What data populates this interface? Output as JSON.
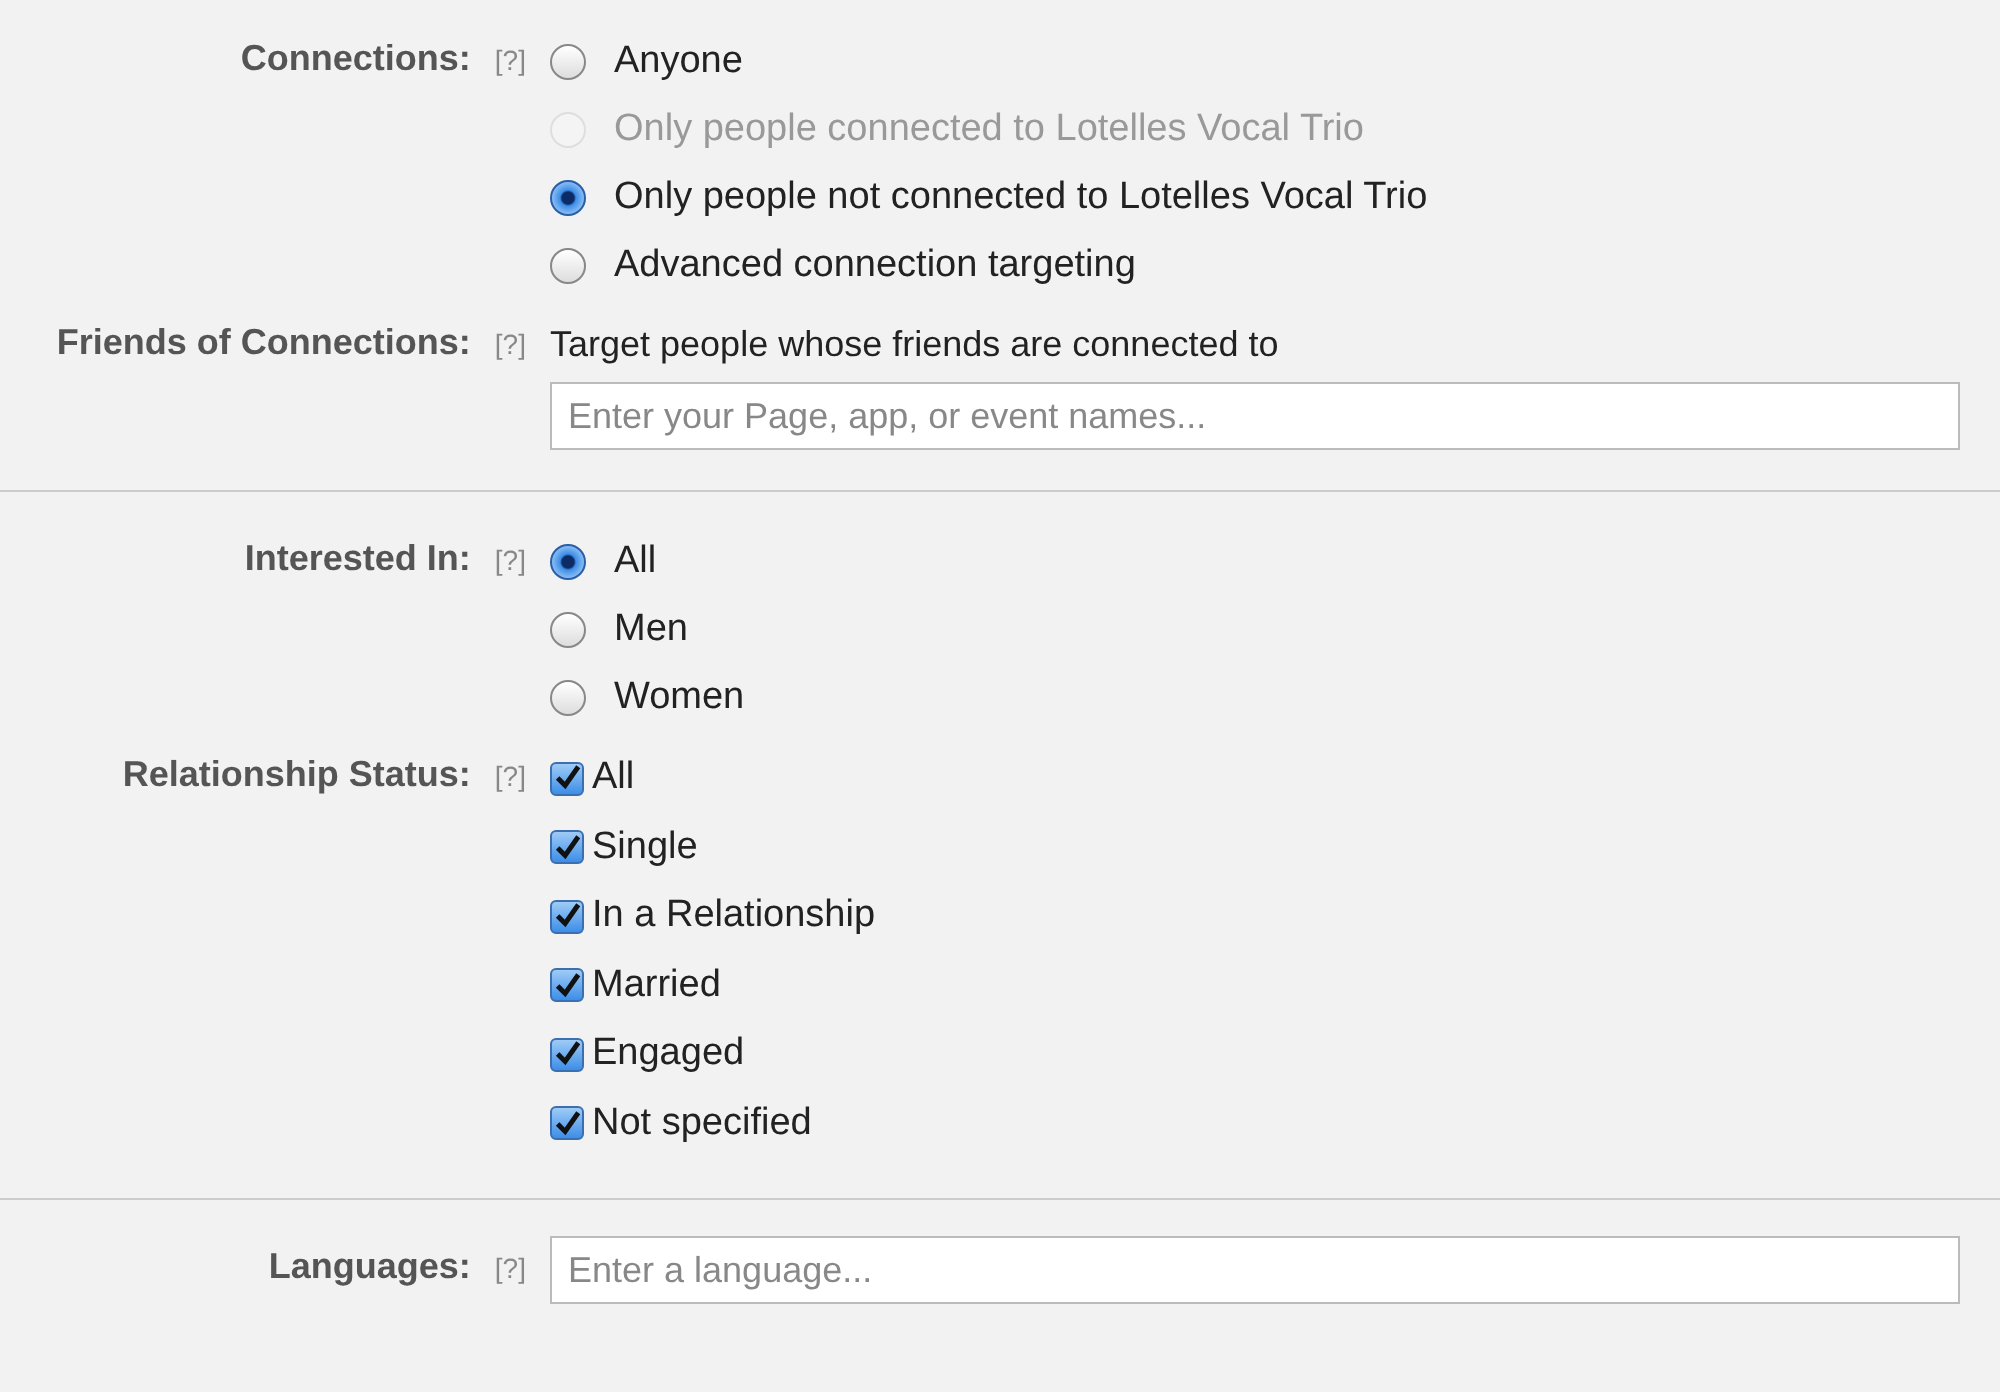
{
  "sections": [
    {
      "fields": [
        {
          "label": "Connections:",
          "help": "[?]",
          "kind": "radio",
          "options": [
            {
              "label": "Anyone",
              "selected": false,
              "disabled": false
            },
            {
              "label": "Only people connected to Lotelles Vocal Trio",
              "selected": false,
              "disabled": true
            },
            {
              "label": "Only people not connected to Lotelles Vocal Trio",
              "selected": true,
              "disabled": false
            },
            {
              "label": "Advanced connection targeting",
              "selected": false,
              "disabled": false
            }
          ]
        },
        {
          "label": "Friends of Connections:",
          "help": "[?]",
          "kind": "text",
          "description": "Target people whose friends are connected to",
          "placeholder": "Enter your Page, app, or event names..."
        }
      ]
    },
    {
      "fields": [
        {
          "label": "Interested In:",
          "help": "[?]",
          "kind": "radio",
          "options": [
            {
              "label": "All",
              "selected": true,
              "disabled": false
            },
            {
              "label": "Men",
              "selected": false,
              "disabled": false
            },
            {
              "label": "Women",
              "selected": false,
              "disabled": false
            }
          ]
        },
        {
          "label": "Relationship Status:",
          "help": "[?]",
          "kind": "checkbox",
          "options": [
            {
              "label": "All",
              "checked": true
            },
            {
              "label": "Single",
              "checked": true
            },
            {
              "label": "In a Relationship",
              "checked": true
            },
            {
              "label": "Married",
              "checked": true
            },
            {
              "label": "Engaged",
              "checked": true
            },
            {
              "label": "Not specified",
              "checked": true
            }
          ]
        }
      ]
    },
    {
      "fields": [
        {
          "label": "Languages:",
          "help": "[?]",
          "kind": "text",
          "placeholder": "Enter a language..."
        }
      ]
    }
  ]
}
